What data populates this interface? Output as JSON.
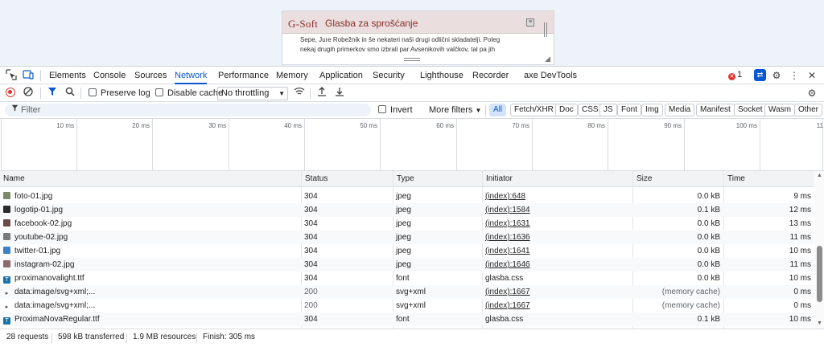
{
  "preview": {
    "logo": "G-Soft",
    "title": "Glasba za sprošćanje",
    "body_line1": "Sepe, Jure Robežnik in še nekateri naši drugi odlični skladatelji. Poleg",
    "body_line2": "nekaj drugih primerkov smo izbrali par Avsenikovih valčkov, tal pa jih"
  },
  "tabs": [
    "Elements",
    "Console",
    "Sources",
    "Network",
    "Performance",
    "Memory",
    "Application",
    "Security",
    "Lighthouse",
    "Recorder",
    "axe DevTools"
  ],
  "active_tab": "Network",
  "error_count": "1",
  "toolbar": {
    "preserve_log": "Preserve log",
    "disable_cache": "Disable cache",
    "throttling": "No throttling"
  },
  "filter": {
    "placeholder": "Filter",
    "invert": "Invert",
    "more_filters": "More filters",
    "types": [
      "All",
      "Fetch/XHR",
      "Doc",
      "CSS",
      "JS",
      "Font",
      "Img",
      "Media",
      "Manifest",
      "Socket",
      "Wasm",
      "Other"
    ]
  },
  "timeline": {
    "ticks": [
      "10 ms",
      "20 ms",
      "30 ms",
      "40 ms",
      "50 ms",
      "60 ms",
      "70 ms",
      "80 ms",
      "90 ms",
      "100 ms",
      "11"
    ]
  },
  "table": {
    "columns": [
      "Name",
      "Status",
      "Type",
      "Initiator",
      "Size",
      "Time"
    ],
    "rows": [
      {
        "name": "foto-01.jpg",
        "icon": "image-file-icon",
        "icon_color": "#7a8a6a",
        "status": "304",
        "type": "jpeg",
        "initiator": "(index):648",
        "initiator_link": true,
        "size": "0.0 kB",
        "time": "9 ms"
      },
      {
        "name": "logotip-01.jpg",
        "icon": "image-file-icon",
        "icon_color": "#2b2b2b",
        "status": "304",
        "type": "jpeg",
        "initiator": "(index):1584",
        "initiator_link": true,
        "size": "0.1 kB",
        "time": "12 ms"
      },
      {
        "name": "facebook-02.jpg",
        "icon": "image-file-icon",
        "icon_color": "#6b4a4a",
        "status": "304",
        "type": "jpeg",
        "initiator": "(index):1631",
        "initiator_link": true,
        "size": "0.0 kB",
        "time": "13 ms"
      },
      {
        "name": "youtube-02.jpg",
        "icon": "image-file-icon",
        "icon_color": "#7a7a7a",
        "status": "304",
        "type": "jpeg",
        "initiator": "(index):1636",
        "initiator_link": true,
        "size": "0.0 kB",
        "time": "11 ms"
      },
      {
        "name": "twitter-01.jpg",
        "icon": "image-file-icon",
        "icon_color": "#3b82c4",
        "status": "304",
        "type": "jpeg",
        "initiator": "(index):1641",
        "initiator_link": true,
        "size": "0.0 kB",
        "time": "10 ms"
      },
      {
        "name": "instagram-02.jpg",
        "icon": "image-file-icon",
        "icon_color": "#8a6a6a",
        "status": "304",
        "type": "jpeg",
        "initiator": "(index):1646",
        "initiator_link": true,
        "size": "0.0 kB",
        "time": "11 ms"
      },
      {
        "name": "proximanovalight.ttf",
        "icon": "font-file-icon",
        "icon_color": "#1a73a8",
        "status": "304",
        "type": "font",
        "initiator": "glasba.css",
        "initiator_link": false,
        "size": "0.0 kB",
        "time": "10 ms"
      },
      {
        "name": "data:image/svg+xml;...",
        "icon": "svg-file-icon",
        "icon_color": "#444444",
        "status": "200",
        "type": "svg+xml",
        "initiator": "(index):1667",
        "initiator_link": true,
        "size": "(memory cache)",
        "time": "0 ms",
        "muted": true
      },
      {
        "name": "data:image/svg+xml;...",
        "icon": "svg-file-icon",
        "icon_color": "#444444",
        "status": "200",
        "type": "svg+xml",
        "initiator": "(index):1667",
        "initiator_link": true,
        "size": "(memory cache)",
        "time": "0 ms",
        "muted": true
      },
      {
        "name": "ProximaNovaRegular.ttf",
        "icon": "font-file-icon",
        "icon_color": "#1a73a8",
        "status": "304",
        "type": "font",
        "initiator": "glasba.css",
        "initiator_link": false,
        "size": "0.1 kB",
        "time": "10 ms"
      }
    ]
  },
  "status": {
    "requests": "28 requests",
    "transferred": "598 kB transferred",
    "resources": "1.9 MB resources",
    "finish": "Finish: 305 ms"
  }
}
